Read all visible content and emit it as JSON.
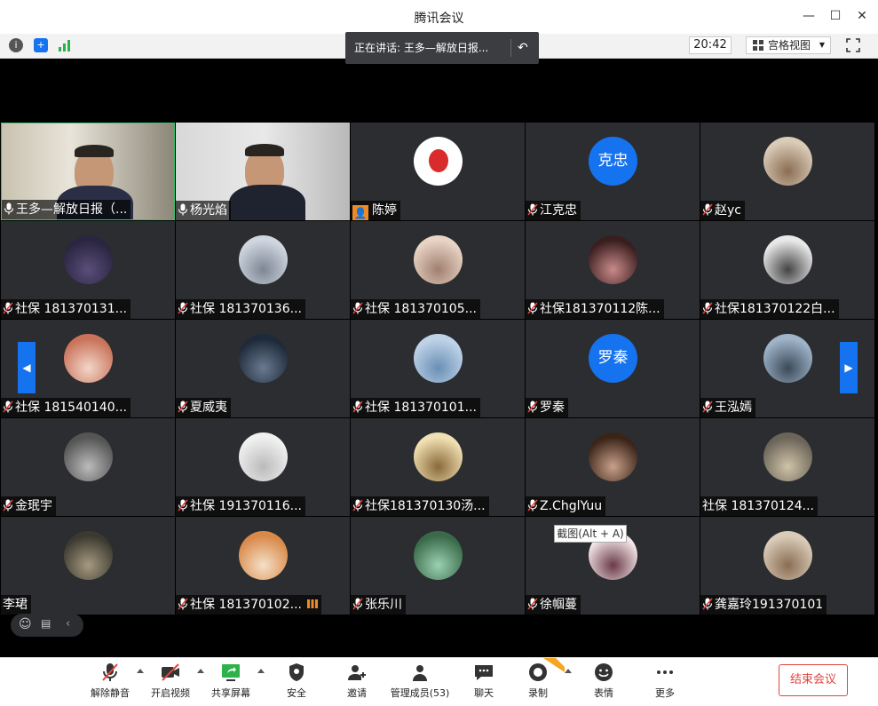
{
  "window": {
    "title": "腾讯会议"
  },
  "infobar": {
    "time": "20:42",
    "view_label": "宫格视图",
    "speaking": "正在讲话: 王多—解放日报..."
  },
  "tooltip": "截图(Alt + A)",
  "participants": [
    {
      "name": "王多—解放日报（...",
      "mic": "on",
      "avatar": "video"
    },
    {
      "name": "杨光焰",
      "mic": "on",
      "avatar": "video"
    },
    {
      "name": "陈婷",
      "mic": "none",
      "avatar": "lantern"
    },
    {
      "name": "江克忠",
      "mic": "muted",
      "avatar": "text",
      "avatar_text": "克忠"
    },
    {
      "name": "赵yc",
      "mic": "muted",
      "avatar": "photo"
    },
    {
      "name": "社保 181370131...",
      "mic": "muted",
      "avatar": "photo"
    },
    {
      "name": "社保 181370136...",
      "mic": "muted",
      "avatar": "photo"
    },
    {
      "name": "社保 181370105...",
      "mic": "muted",
      "avatar": "photo"
    },
    {
      "name": "社保181370112陈...",
      "mic": "muted",
      "avatar": "photo"
    },
    {
      "name": "社保181370122白...",
      "mic": "muted",
      "avatar": "photo"
    },
    {
      "name": "社保 181540140...",
      "mic": "muted",
      "avatar": "photo"
    },
    {
      "name": "夏威夷",
      "mic": "muted",
      "avatar": "photo"
    },
    {
      "name": "社保 181370101...",
      "mic": "muted",
      "avatar": "photo"
    },
    {
      "name": "罗秦",
      "mic": "muted",
      "avatar": "text",
      "avatar_text": "罗秦"
    },
    {
      "name": "王泓嫣",
      "mic": "muted",
      "avatar": "photo"
    },
    {
      "name": "金珉宇",
      "mic": "muted",
      "avatar": "photo"
    },
    {
      "name": "社保 191370116...",
      "mic": "muted",
      "avatar": "photo"
    },
    {
      "name": "社保181370130汤...",
      "mic": "muted",
      "avatar": "photo"
    },
    {
      "name": "Z.ChglYuu",
      "mic": "muted",
      "avatar": "photo"
    },
    {
      "name": "社保 181370124...",
      "mic": "none",
      "avatar": "photo"
    },
    {
      "name": "李珺",
      "mic": "none",
      "avatar": "photo"
    },
    {
      "name": "社保 181370102...",
      "mic": "muted",
      "avatar": "photo"
    },
    {
      "name": "张乐川",
      "mic": "muted",
      "avatar": "photo"
    },
    {
      "name": "徐帼蔓",
      "mic": "muted",
      "avatar": "photo"
    },
    {
      "name": "龚嘉玲191370101",
      "mic": "muted",
      "avatar": "photo"
    }
  ],
  "toolbar": {
    "unmute": "解除静音",
    "start_video": "开启视频",
    "share_screen": "共享屏幕",
    "security": "安全",
    "invite": "邀请",
    "manage_members": "管理成员(53)",
    "chat": "聊天",
    "record": "录制",
    "reactions": "表情",
    "more": "更多",
    "end_meeting": "结束会议"
  },
  "colors": {
    "accent": "#1673f0",
    "tile_bg": "#2b2d30",
    "active_border": "#37c36b",
    "end_red": "#e0443e",
    "avatar_blue": "#1673f0"
  }
}
